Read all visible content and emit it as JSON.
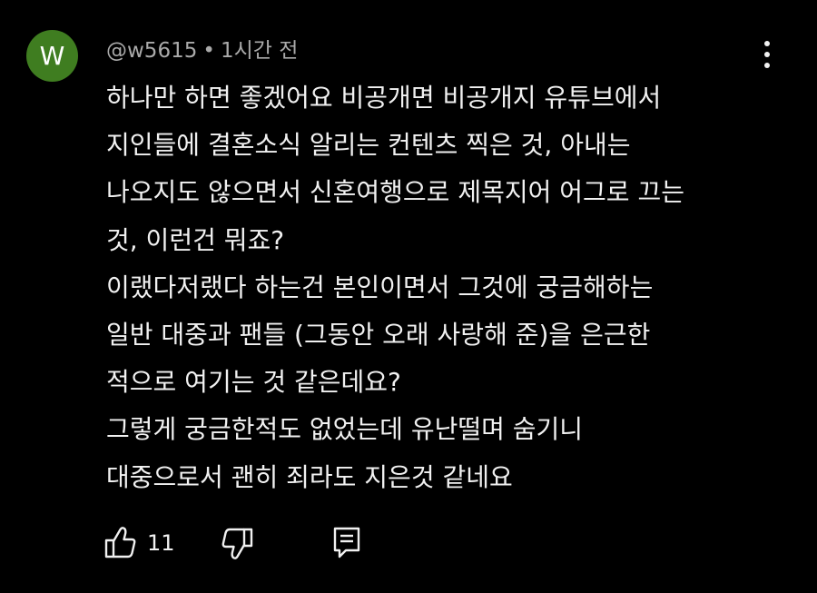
{
  "comment": {
    "avatar_letter": "W",
    "avatar_color": "#3f7d20",
    "author": "@w5615",
    "separator": "•",
    "time": "1시간 전",
    "lines": [
      "하나만 하면 좋겠어요 비공개면 비공개지 유튜브에서",
      "지인들에 결혼소식 알리는 컨텐츠 찍은 것, 아내는",
      "나오지도 않으면서 신혼여행으로 제목지어 어그로 끄는",
      "것, 이런건 뭐죠?",
      "이랬다저랬다 하는건 본인이면서 그것에 궁금해하는",
      "일반 대중과 팬들 (그동안 오래 사랑해 준)을 은근한",
      "적으로 여기는 것 같은데요?",
      "그렇게 궁금한적도 없었는데 유난떨며 숨기니",
      "대중으로서 괜히 죄라도 지은것 같네요"
    ],
    "like_count": "11"
  },
  "icons": {
    "like": "thumbs-up-icon",
    "dislike": "thumbs-down-icon",
    "reply": "reply-icon",
    "menu": "more-vertical-icon"
  }
}
